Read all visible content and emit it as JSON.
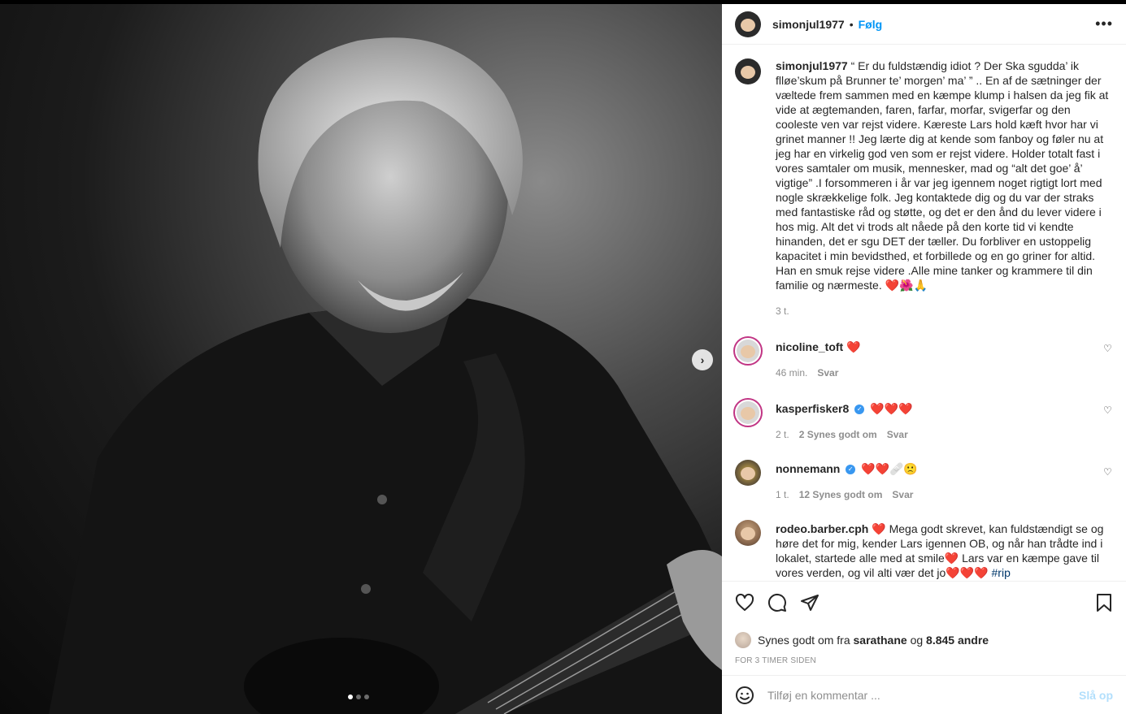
{
  "post": {
    "username": "simonjul1977",
    "follow_label": "Følg",
    "bullet": "•",
    "more_icon": "more-horizontal-icon"
  },
  "caption": {
    "username": "simonjul1977",
    "text": "“ Er du fuldstændig idiot ? Der Ska sgudda’ ik flløe’skum på Brunner te’ morgen’ ma’ ” .. En af de sætninger der væltede frem sammen med en kæmpe klump i halsen da jeg fik at vide at ægtemanden, faren, farfar, morfar, svigerfar og den cooleste ven var rejst videre. Kæreste Lars hold kæft hvor har vi grinet manner !! Jeg lærte dig at kende som fanboy og føler nu at jeg har en virkelig god ven som er rejst videre. Holder totalt fast i vores samtaler om musik, mennesker, mad og “alt det goe’ å’ vigtige” .I forsommeren i år var jeg igennem noget rigtigt lort med nogle skrækkelige folk. Jeg kontaktede dig og du var der straks med fantastiske råd og støtte, og det er den ånd du lever videre i hos mig. Alt det vi trods alt nåede på den korte tid vi kendte hinanden, det er sgu DET der tæller. Du forbliver en ustoppelig kapacitet i min bevidsthed, et forbillede og en go griner for altid. Han en smuk rejse videre .Alle mine tanker og krammere til din familie og nærmeste.",
    "emojis": "❤️🌺🙏",
    "time": "3 t."
  },
  "comments": [
    {
      "username": "nicoline_toft",
      "verified": false,
      "text": "",
      "emojis": "❤️",
      "time": "46 min.",
      "likes": "",
      "reply": "Svar"
    },
    {
      "username": "kasperfisker8",
      "verified": true,
      "text": "",
      "emojis": "❤️❤️❤️",
      "time": "2 t.",
      "likes": "2 Synes godt om",
      "reply": "Svar"
    },
    {
      "username": "nonnemann",
      "verified": true,
      "text": "",
      "emojis": "❤️❤️🩹🙁",
      "time": "1 t.",
      "likes": "12 Synes godt om",
      "reply": "Svar"
    },
    {
      "username": "rodeo.barber.cph",
      "verified": false,
      "text_a": "Mega godt skrevet, kan fuldstændigt se og høre det for mig, kender Lars igennen OB, og når han trådte ind i lokalet, startede alle med at smile",
      "text_b": "Lars var en kæmpe gave til vores verden, og vil alti vær det jo",
      "hashtag": "#rip",
      "heart": "❤️",
      "hearts3": "❤️❤️❤️"
    }
  ],
  "likes": {
    "prefix": "Synes godt om fra",
    "user": "sarathane",
    "joiner": "og",
    "count": "8.845 andre"
  },
  "timestamp": "FOR 3 TIMER SIDEN",
  "add_comment": {
    "placeholder": "Tilføj en kommentar ...",
    "post_label": "Slå op"
  },
  "carousel": {
    "next_label": "›",
    "slides": 3,
    "active": 0
  },
  "colors": {
    "accent": "#0095f6",
    "heart": "#e0245e",
    "muted": "#8e8e8e"
  }
}
